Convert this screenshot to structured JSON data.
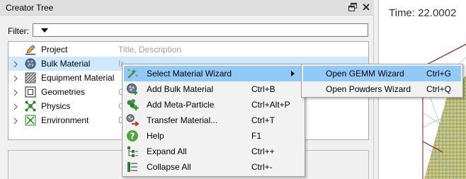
{
  "panel": {
    "title": "Creator Tree"
  },
  "filter": {
    "label": "Filter:",
    "value": ""
  },
  "tree": {
    "items": [
      {
        "label": "Project",
        "description": "Title, Description",
        "expandable": false,
        "icon": "pencil-icon"
      },
      {
        "label": "Bulk Material",
        "description": "Interactions, Size, Shape",
        "expandable": true,
        "icon": "bulk-material-icon"
      },
      {
        "label": "Equipment Material",
        "description": "",
        "expandable": true,
        "icon": "equipment-material-icon"
      },
      {
        "label": "Geometries",
        "description": "C",
        "expandable": true,
        "icon": "geometry-icon"
      },
      {
        "label": "Physics",
        "description": "C",
        "expandable": true,
        "icon": "physics-icon"
      },
      {
        "label": "Environment",
        "description": "D",
        "expandable": true,
        "icon": "environment-icon"
      }
    ]
  },
  "context_menu": {
    "items": [
      {
        "label": "Select Material Wizard",
        "shortcut": "",
        "icon": "wizard-icon",
        "submenu": true
      },
      {
        "label": "Add Bulk Material",
        "shortcut": "Ctrl+B",
        "icon": "add-bulk-icon"
      },
      {
        "label": "Add Meta-Particle",
        "shortcut": "Ctrl+Alt+P",
        "icon": "meta-particle-icon"
      },
      {
        "label": "Transfer Material...",
        "shortcut": "Ctrl+T",
        "icon": "transfer-icon"
      },
      {
        "label": "Help",
        "shortcut": "F1",
        "icon": "help-icon"
      },
      {
        "label": "Expand All",
        "shortcut": "Ctrl++",
        "icon": "expand-all-icon"
      },
      {
        "label": "Collapse All",
        "shortcut": "Ctrl+-",
        "icon": "collapse-all-icon"
      }
    ]
  },
  "submenu": {
    "items": [
      {
        "label": "Open GEMM Wizard",
        "shortcut": "Ctrl+G"
      },
      {
        "label": "Open Powders Wizard",
        "shortcut": "Ctrl+Q"
      }
    ]
  },
  "viewport": {
    "time_label": "Time: 22.0002"
  },
  "colors": {
    "selection": "#cde8ff",
    "menu_highlight": "#91c9f7",
    "particles": "#b8bc7a"
  }
}
